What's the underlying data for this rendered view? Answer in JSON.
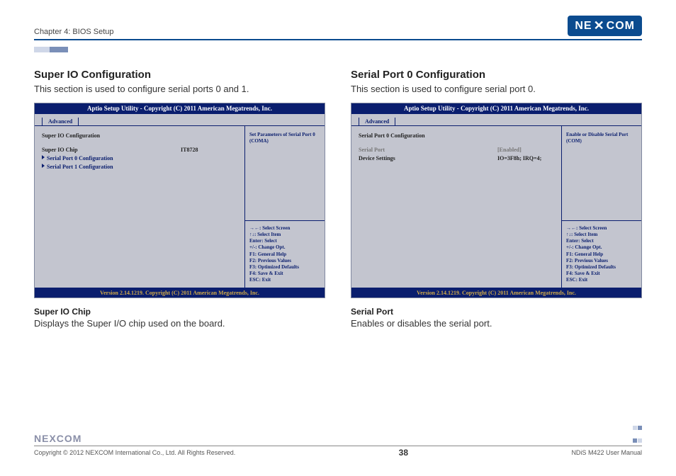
{
  "header": {
    "chapter": "Chapter 4: BIOS Setup",
    "logo_text": "NE",
    "logo_x": "X",
    "logo_text2": "COM"
  },
  "left": {
    "title": "Super IO Configuration",
    "subtitle": "This section is used to configure serial ports 0 and 1.",
    "bios": {
      "title": "Aptio Setup Utility - Copyright (C) 2011 American Megatrends, Inc.",
      "tab": "Advanced",
      "section_header": "Super IO Configuration",
      "row1_label": "Super IO Chip",
      "row1_value": "IT8728",
      "link1": "Serial Port 0 Configuration",
      "link2": "Serial Port 1 Configuration",
      "help": "Set Parameters of Serial Port 0 (COMA)",
      "footer": "Version 2.14.1219. Copyright (C) 2011 American Megatrends, Inc."
    },
    "field_title": "Super IO Chip",
    "field_desc": "Displays the Super I/O chip used on the board."
  },
  "right": {
    "title": "Serial Port 0 Configuration",
    "subtitle": "This section is used to configure serial port 0.",
    "bios": {
      "title": "Aptio Setup Utility - Copyright (C) 2011 American Megatrends, Inc.",
      "tab": "Advanced",
      "section_header": "Serial Port 0 Configuration",
      "row1_label": "Serial Port",
      "row1_value": "[Enabled]",
      "row2_label": "Device Settings",
      "row2_value": "IO=3F8h; IRQ=4;",
      "help": "Enable or Disable Serial Port (COM)",
      "footer": "Version 2.14.1219. Copyright (C) 2011 American Megatrends, Inc."
    },
    "field_title": "Serial Port",
    "field_desc": "Enables or disables the serial port."
  },
  "keys": {
    "k1": "→←: Select Screen",
    "k2": "↑↓: Select Item",
    "k3": "Enter: Select",
    "k4": "+/-: Change Opt.",
    "k5": "F1: General Help",
    "k6": "F2: Previous Values",
    "k7": "F3: Optimized Defaults",
    "k8": "F4: Save & Exit",
    "k9": "ESC: Exit"
  },
  "footer": {
    "logo": "NEXCOM",
    "copyright": "Copyright © 2012 NEXCOM International Co., Ltd. All Rights Reserved.",
    "page": "38",
    "doc": "NDiS M422 User Manual"
  }
}
